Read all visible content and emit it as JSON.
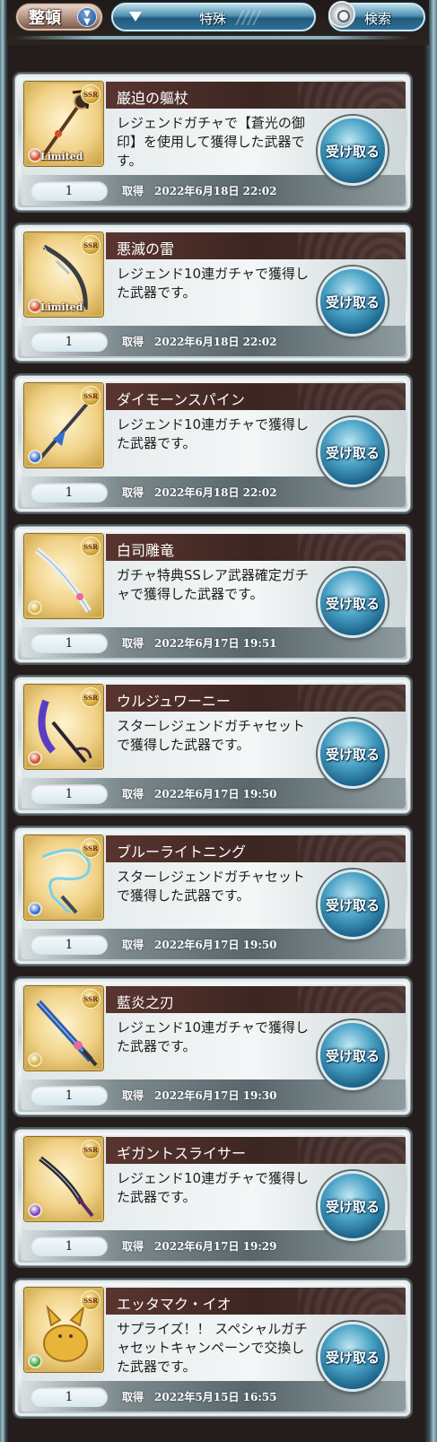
{
  "header": {
    "sort_label": "整頓",
    "filter_label": "特殊",
    "search_label": "検索"
  },
  "colors": {
    "fire": "#d84a2c",
    "water": "#2f6fd6",
    "wind": "#3aa83a",
    "light": "#d9b43a",
    "dark": "#7a3fc4"
  },
  "items": [
    {
      "name": "巌迫の軀杖",
      "description": "レジェンドガチャで【蒼光の御印】を使用して獲得した武器です。",
      "quantity": "1",
      "acquired_label": "取得",
      "acquired_date": "2022年6月18日 22:02",
      "receive_label": "受け取る",
      "rarity": "SSR",
      "element": "fire",
      "limited": "Limited",
      "icon": "staff-icon"
    },
    {
      "name": "悪滅の雷",
      "description": "レジェンド10連ガチャで獲得した武器です。",
      "quantity": "1",
      "acquired_label": "取得",
      "acquired_date": "2022年6月18日 22:02",
      "receive_label": "受け取る",
      "rarity": "SSR",
      "element": "fire",
      "limited": "Limited",
      "icon": "bow-icon"
    },
    {
      "name": "ダイモーンスパイン",
      "description": "レジェンド10連ガチャで獲得した武器です。",
      "quantity": "1",
      "acquired_label": "取得",
      "acquired_date": "2022年6月18日 22:02",
      "receive_label": "受け取る",
      "rarity": "SSR",
      "element": "water",
      "limited": "",
      "icon": "spear-icon"
    },
    {
      "name": "白司雕竜",
      "description": "ガチャ特典SSレア武器確定ガチャで獲得した武器です。",
      "quantity": "1",
      "acquired_label": "取得",
      "acquired_date": "2022年6月17日 19:51",
      "receive_label": "受け取る",
      "rarity": "SSR",
      "element": "light",
      "limited": "",
      "icon": "sword-icon"
    },
    {
      "name": "ウルジュワーニー",
      "description": "スターレジェンドガチャセットで獲得した武器です。",
      "quantity": "1",
      "acquired_label": "取得",
      "acquired_date": "2022年6月17日 19:50",
      "receive_label": "受け取る",
      "rarity": "SSR",
      "element": "fire",
      "limited": "",
      "icon": "scythe-icon"
    },
    {
      "name": "ブルーライトニング",
      "description": "スターレジェンドガチャセットで獲得した武器です。",
      "quantity": "1",
      "acquired_label": "取得",
      "acquired_date": "2022年6月17日 19:50",
      "receive_label": "受け取る",
      "rarity": "SSR",
      "element": "water",
      "limited": "",
      "icon": "whip-icon"
    },
    {
      "name": "藍炎之刃",
      "description": "レジェンド10連ガチャで獲得した武器です。",
      "quantity": "1",
      "acquired_label": "取得",
      "acquired_date": "2022年6月17日 19:30",
      "receive_label": "受け取る",
      "rarity": "SSR",
      "element": "light",
      "limited": "",
      "icon": "blade-icon"
    },
    {
      "name": "ギガントスライサー",
      "description": "レジェンド10連ガチャで獲得した武器です。",
      "quantity": "1",
      "acquired_label": "取得",
      "acquired_date": "2022年6月17日 19:29",
      "receive_label": "受け取る",
      "rarity": "SSR",
      "element": "dark",
      "limited": "",
      "icon": "katana-icon"
    },
    {
      "name": "エッタマク・イオ",
      "description": "サプライズ！！ スペシャルガチャセットキャンペーンで交換した武器です。",
      "quantity": "1",
      "acquired_label": "取得",
      "acquired_date": "2022年5月15日 16:55",
      "receive_label": "受け取る",
      "rarity": "SSR",
      "element": "wind",
      "limited": "",
      "icon": "golden-fox-icon"
    }
  ]
}
